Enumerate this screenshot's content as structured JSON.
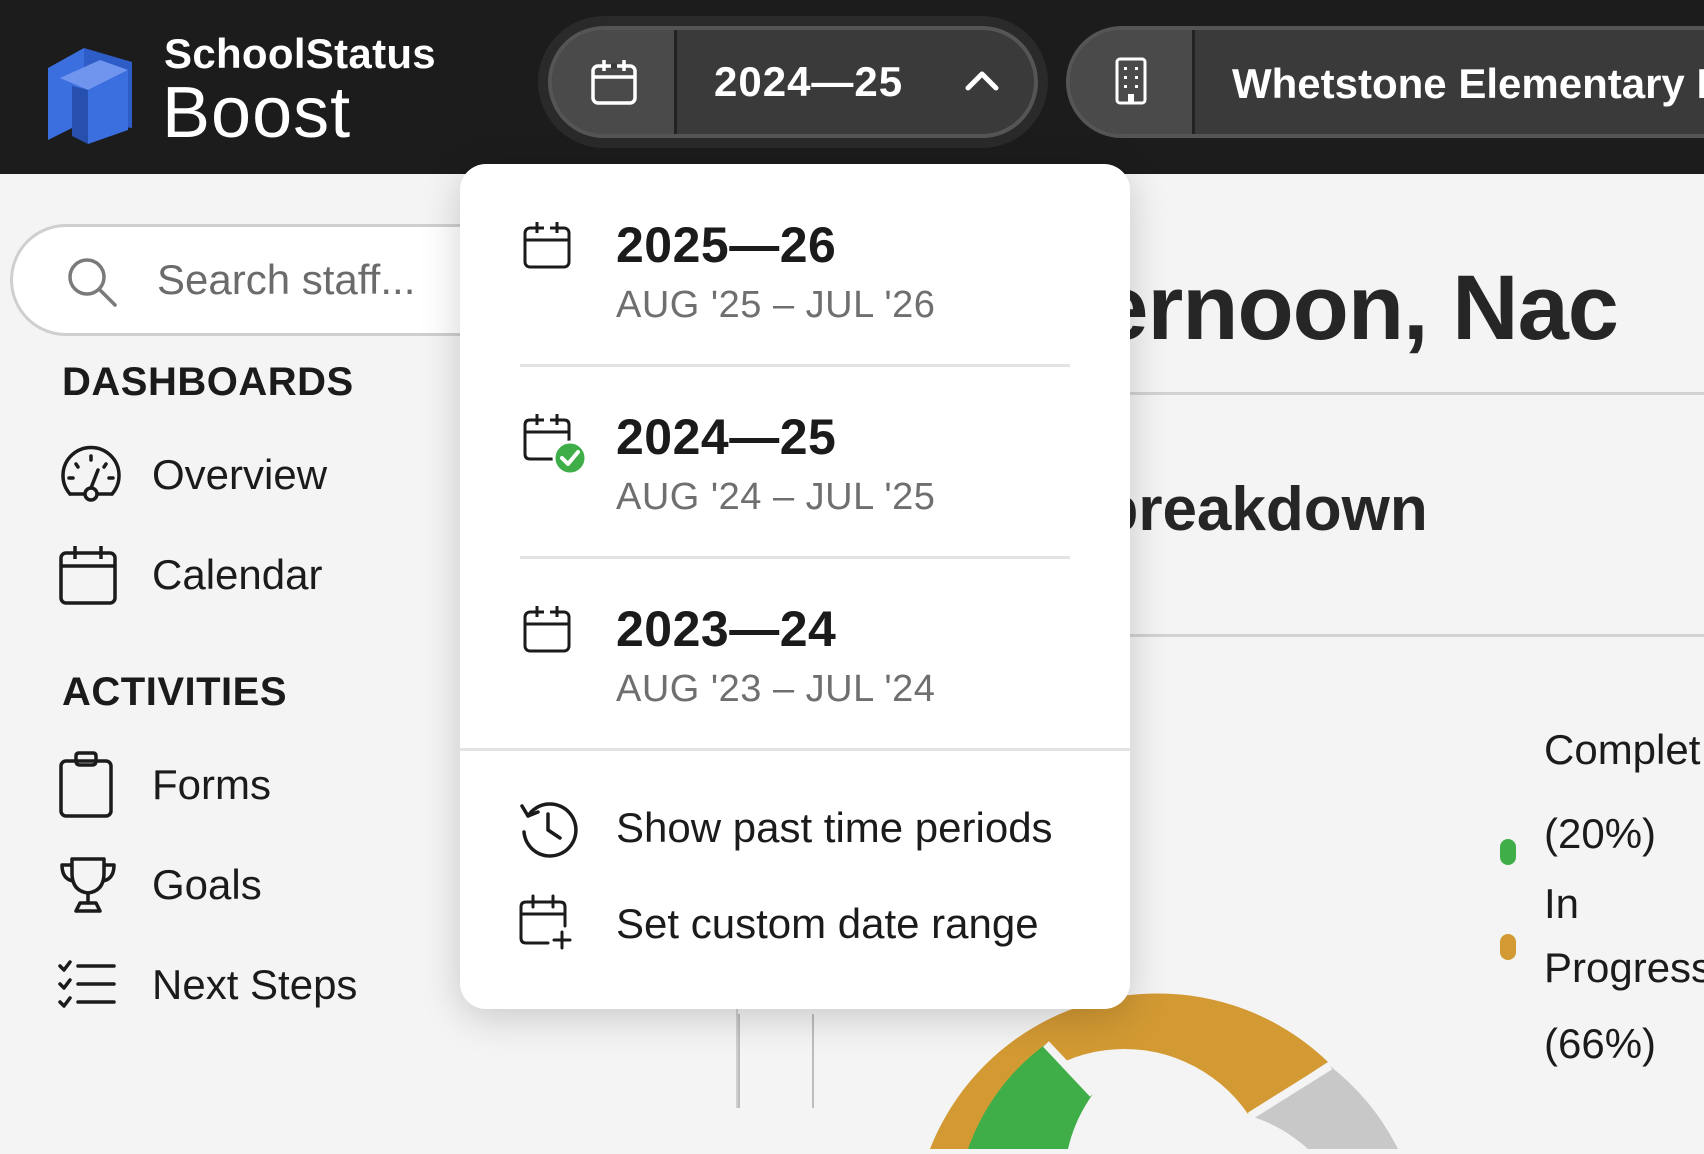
{
  "brand": {
    "line1": "SchoolStatus",
    "line2": "Boost",
    "color": "#3b6fe0"
  },
  "header": {
    "year_selector": {
      "value": "2024—25",
      "icon": "calendar-icon",
      "state": "expanded"
    },
    "school_selector": {
      "value": "Whetstone Elementary I",
      "icon": "building-icon"
    }
  },
  "sidebar": {
    "search": {
      "placeholder": "Search staff..."
    },
    "sections": [
      {
        "title": "DASHBOARDS",
        "items": [
          {
            "label": "Overview",
            "icon": "speedometer-icon"
          },
          {
            "label": "Calendar",
            "icon": "calendar-icon"
          }
        ]
      },
      {
        "title": "ACTIVITIES",
        "items": [
          {
            "label": "Forms",
            "icon": "clipboard-icon"
          },
          {
            "label": "Goals",
            "icon": "trophy-icon"
          },
          {
            "label": "Next Steps",
            "icon": "checklist-icon"
          }
        ]
      }
    ]
  },
  "main": {
    "greeting": "fternoon, Nac",
    "section_heading": "/ breakdown",
    "legend": [
      {
        "line1": "Complet",
        "line2": "(20%)",
        "color": "#3fae49"
      },
      {
        "line1": "In",
        "line2": "Progress",
        "line3": "(66%)",
        "color": "#d39a33"
      }
    ],
    "donut": {
      "complete_pct": 20,
      "in_progress_pct": 66,
      "other_color": "#c8c8c8"
    }
  },
  "dropdown": {
    "options": [
      {
        "title": "2025—26",
        "range": "AUG '25 – JUL '26",
        "selected": false
      },
      {
        "title": "2024—25",
        "range": "AUG '24 – JUL '25",
        "selected": true
      },
      {
        "title": "2023—24",
        "range": "AUG '23 – JUL '24",
        "selected": false
      }
    ],
    "actions": [
      {
        "label": "Show past time periods",
        "icon": "history-icon"
      },
      {
        "label": "Set custom date range",
        "icon": "calendar-plus-icon"
      }
    ],
    "check_color": "#3fae49"
  }
}
